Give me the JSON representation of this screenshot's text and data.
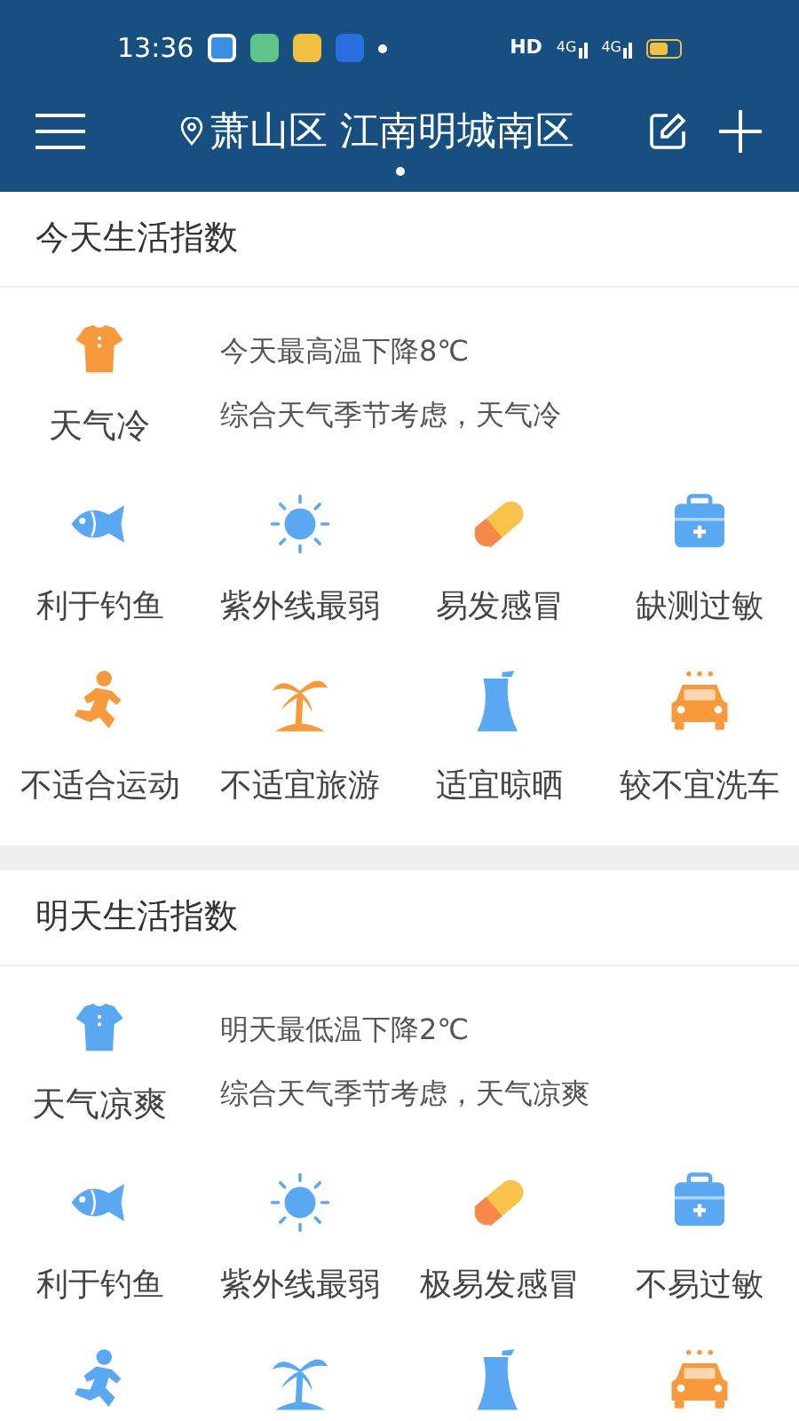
{
  "status_bar": {
    "time": "13:36",
    "network": "HD",
    "signals": [
      "4G",
      "4G"
    ]
  },
  "header": {
    "location": "萧山区 江南明城南区",
    "page_dots": [
      {
        "selected": true
      }
    ]
  },
  "sections": [
    {
      "title": "今天生活指数",
      "summary": {
        "kind": "shirt",
        "color": "#f89a3c",
        "label": "天气冷",
        "lines": [
          "今天最高温下降8℃",
          "综合天气季节考虑，天气冷"
        ]
      },
      "items": [
        {
          "kind": "fish",
          "color": "#5aa8f2",
          "label": "利于钓鱼"
        },
        {
          "kind": "sun",
          "color": "#5aa8f2",
          "label": "紫外线最弱"
        },
        {
          "kind": "pill",
          "color": "#f7884a",
          "label": "易发感冒"
        },
        {
          "kind": "kit",
          "color": "#5aa8f2",
          "label": "缺测过敏"
        },
        {
          "kind": "runner",
          "color": "#f89a3c",
          "label": "不适合运动"
        },
        {
          "kind": "palm",
          "color": "#f89a3c",
          "label": "不适宜旅游"
        },
        {
          "kind": "tower",
          "color": "#5aa8f2",
          "label": "适宜晾晒"
        },
        {
          "kind": "car",
          "color": "#f89a3c",
          "label": "较不宜洗车"
        }
      ]
    },
    {
      "title": "明天生活指数",
      "summary": {
        "kind": "shirt",
        "color": "#5aa8f2",
        "label": "天气凉爽",
        "lines": [
          "明天最低温下降2℃",
          "综合天气季节考虑，天气凉爽"
        ]
      },
      "items": [
        {
          "kind": "fish",
          "color": "#5aa8f2",
          "label": "利于钓鱼"
        },
        {
          "kind": "sun",
          "color": "#5aa8f2",
          "label": "紫外线最弱"
        },
        {
          "kind": "pill",
          "color": "#f7884a",
          "label": "极易发感冒"
        },
        {
          "kind": "kit",
          "color": "#5aa8f2",
          "label": "不易过敏"
        },
        {
          "kind": "runner",
          "color": "#5aa8f2"
        },
        {
          "kind": "palm",
          "color": "#5aa8f2"
        },
        {
          "kind": "tower",
          "color": "#5aa8f2"
        },
        {
          "kind": "car",
          "color": "#f89a3c"
        }
      ]
    }
  ]
}
